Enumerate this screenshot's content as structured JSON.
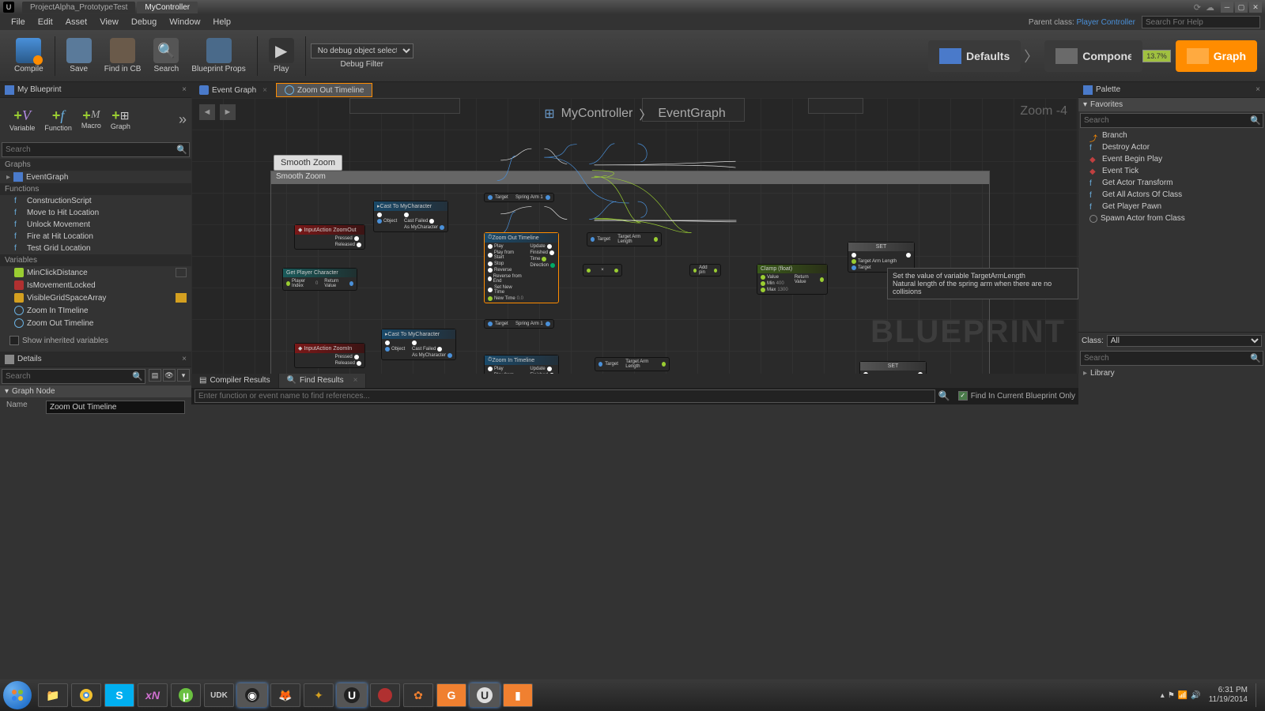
{
  "titlebar": {
    "tabs": [
      "ProjectAlpha_PrototypeTest",
      "MyController"
    ],
    "active": 1
  },
  "menu": [
    "File",
    "Edit",
    "Asset",
    "View",
    "Debug",
    "Window",
    "Help"
  ],
  "parentClassLabel": "Parent class:",
  "parentClass": "Player Controller",
  "searchHelpPlaceholder": "Search For Help",
  "toolbar": {
    "compile": "Compile",
    "save": "Save",
    "findcb": "Find in CB",
    "search": "Search",
    "bpprops": "Blueprint Props",
    "play": "Play",
    "debugSel": "No debug object selected",
    "debugFilter": "Debug Filter"
  },
  "modes": {
    "defaults": "Defaults",
    "components": "Components",
    "graph": "Graph",
    "battery": "13.7%"
  },
  "myBlueprint": {
    "title": "My Blueprint",
    "addButtons": [
      "Variable",
      "Function",
      "Macro",
      "Graph"
    ],
    "searchPlaceholder": "Search",
    "catGraphs": "Graphs",
    "eventGraph": "EventGraph",
    "catFunctions": "Functions",
    "functions": [
      "ConstructionScript",
      "Move to Hit Location",
      "Unlock Movement",
      "Fire at Hit Location",
      "Test Grid Location"
    ],
    "catVariables": "Variables",
    "variables": [
      {
        "name": "MinClickDistance",
        "color": "#9acd32"
      },
      {
        "name": "IsMovementLocked",
        "color": "#b03030"
      },
      {
        "name": "VisibleGridSpaceArray",
        "color": "#d4a020"
      }
    ],
    "timelines": [
      "Zoom In TImeline",
      "Zoom Out Timeline"
    ],
    "showInherited": "Show inherited variables"
  },
  "details": {
    "title": "Details",
    "searchPlaceholder": "Search",
    "graphNode": "Graph Node",
    "nameLabel": "Name",
    "nameValue": "Zoom Out Timeline"
  },
  "graph": {
    "tabs": [
      "Event Graph",
      "Zoom Out Timeline"
    ],
    "activeTab": 1,
    "breadcrumb": [
      "MyController",
      "EventGraph"
    ],
    "zoom": "Zoom -4",
    "watermark": "BLUEPRINT",
    "smoothLabel": "Smooth Zoom",
    "commentTitle": "Smooth Zoom",
    "tooltip": {
      "line1": "Set the value of variable TargetArmLength",
      "line2": "Natural length of the spring arm when there are no collisions"
    },
    "nodes": {
      "inputZoomOut": "InputAction ZoomOut",
      "inputZoomIn": "InputAction ZoomIn",
      "pressed": "Pressed",
      "released": "Released",
      "getPlayerChar": "Get Player Character",
      "playerIndex": "Player Index",
      "returnValue": "Return Value",
      "castTo": "Cast To MyCharacter",
      "object": "Object",
      "castFailed": "Cast Failed",
      "asMyChar": "As MyCharacter",
      "springArm": "Spring Arm 1",
      "target": "Target",
      "zoomOutTL": "Zoom Out Timeline",
      "zoomInTL": "Zoom In Timeline",
      "play": "Play",
      "playFromStart": "Play from Start",
      "stop": "Stop",
      "reverse": "Reverse",
      "reverseFromEnd": "Reverse from End",
      "setNewTime": "Set New Time",
      "newTime": "New Time",
      "newTimeVal": "0.0",
      "update": "Update",
      "finished": "Finished",
      "time": "Time",
      "direction": "Direction",
      "targetArmLen": "Target Arm Length",
      "addpin": "Add pin",
      "clamp": "Clamp (float)",
      "value": "Value",
      "min": "Min",
      "max": "Max",
      "minVal": "400",
      "maxVal": "1300",
      "set": "SET"
    }
  },
  "compilerResults": "Compiler Results",
  "findResults": "Find Results",
  "findPlaceholder": "Enter function or event name to find references...",
  "findInCurrent": "Find In Current Blueprint Only",
  "palette": {
    "title": "Palette",
    "favorites": "Favorites",
    "searchPlaceholder": "Search",
    "items": [
      "Branch",
      "Destroy Actor",
      "Event Begin Play",
      "Event Tick",
      "Get Actor Transform",
      "Get All Actors Of Class",
      "Get Player Pawn",
      "Spawn Actor from Class"
    ],
    "classLabel": "Class:",
    "classValue": "All",
    "library": "Library"
  },
  "taskbar": {
    "time": "6:31 PM",
    "date": "11/19/2014"
  }
}
